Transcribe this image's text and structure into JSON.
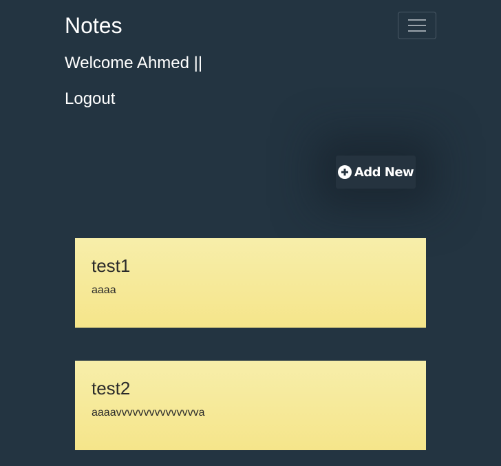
{
  "navbar": {
    "brand": "Notes",
    "toggler_icon": "hamburger-menu-icon",
    "welcome_text": "Welcome Ahmed ||",
    "logout_label": "Logout"
  },
  "actions": {
    "add_icon": "plus-circle-icon",
    "add_label": "Add New"
  },
  "notes": [
    {
      "title": "test1",
      "body": "aaaa"
    },
    {
      "title": "test2",
      "body": "aaaavvvvvvvvvvvvvvva"
    }
  ],
  "colors": {
    "background": "#233441",
    "note_top": "#f7eeaa",
    "note_bottom": "#f5e58a",
    "text_light": "#ffffff",
    "text_dark": "#2a2a2a"
  }
}
